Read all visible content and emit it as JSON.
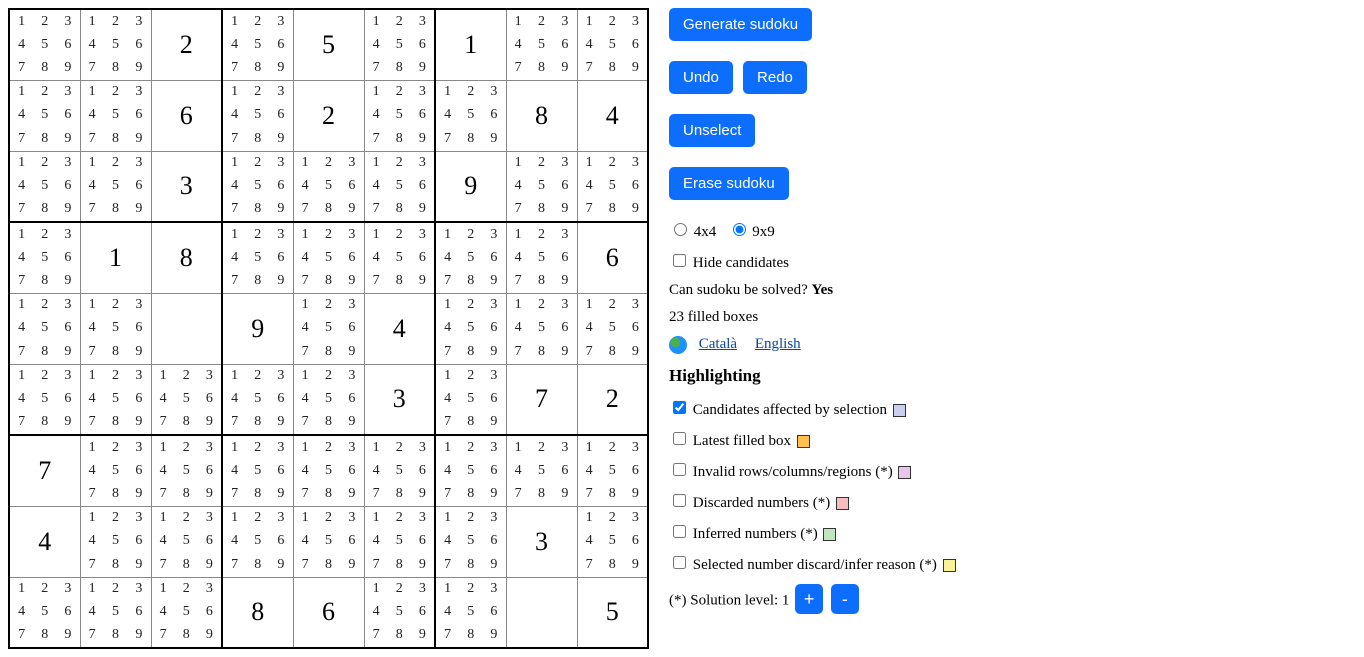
{
  "sudoku": {
    "size": 9,
    "grid": [
      [
        0,
        0,
        2,
        0,
        5,
        0,
        1,
        0,
        0
      ],
      [
        0,
        0,
        6,
        0,
        2,
        0,
        0,
        8,
        4
      ],
      [
        0,
        0,
        3,
        0,
        0,
        0,
        9,
        0,
        0
      ],
      [
        0,
        1,
        8,
        0,
        0,
        0,
        0,
        0,
        6
      ],
      [
        0,
        0,
        0,
        9,
        0,
        4,
        0,
        0,
        0
      ],
      [
        0,
        0,
        0,
        0,
        0,
        3,
        0,
        7,
        2
      ],
      [
        7,
        0,
        0,
        0,
        0,
        0,
        0,
        0,
        0
      ],
      [
        4,
        0,
        0,
        0,
        0,
        0,
        0,
        3,
        0
      ],
      [
        0,
        0,
        0,
        8,
        6,
        0,
        0,
        0,
        5
      ]
    ],
    "candidates_hidden_in": [
      [
        3,
        1
      ],
      [
        4,
        2
      ],
      [
        8,
        7
      ]
    ]
  },
  "controls": {
    "generate": "Generate sudoku",
    "undo": "Undo",
    "redo": "Redo",
    "unselect": "Unselect",
    "erase": "Erase sudoku",
    "size4": "4x4",
    "size9": "9x9",
    "size_selected": "9x9",
    "hide_candidates": "Hide candidates",
    "hide_candidates_checked": false,
    "solvable_q": "Can sudoku be solved? ",
    "solvable_a": "Yes",
    "filled_count": "23 filled boxes",
    "languages": [
      "Català",
      "English"
    ],
    "highlighting_heading": "Highlighting",
    "hl": [
      {
        "label": "Candidates affected by selection",
        "checked": true,
        "color": "#c9d0ef"
      },
      {
        "label": "Latest filled box",
        "checked": false,
        "color": "#ffc04d"
      },
      {
        "label": "Invalid rows/columns/regions (*)",
        "checked": false,
        "color": "#e8c6e8"
      },
      {
        "label": "Discarded numbers (*)",
        "checked": false,
        "color": "#f6bdbd"
      },
      {
        "label": "Inferred numbers (*)",
        "checked": false,
        "color": "#bfe6bf"
      },
      {
        "label": "Selected number discard/infer reason (*)",
        "checked": false,
        "color": "#f7f39a"
      }
    ],
    "solution_level_label": "(*) Solution level: ",
    "solution_level": "1"
  }
}
